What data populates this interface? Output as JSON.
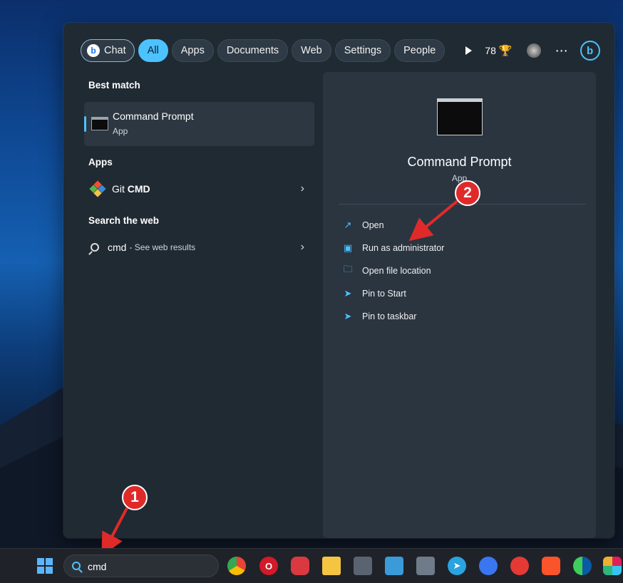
{
  "filters": {
    "chat": "Chat",
    "all": "All",
    "apps": "Apps",
    "documents": "Documents",
    "web": "Web",
    "settings": "Settings",
    "people": "People",
    "points": "78"
  },
  "left": {
    "best_match_label": "Best match",
    "best_match": {
      "title": "Command Prompt",
      "subtitle": "App"
    },
    "apps_label": "Apps",
    "apps": [
      {
        "name_prefix": "Git ",
        "name_bold": "CMD"
      }
    ],
    "web_label": "Search the web",
    "web_result": {
      "query": "cmd",
      "suffix": "- See web results"
    }
  },
  "details": {
    "title": "Command Prompt",
    "subtitle": "App",
    "actions": [
      {
        "label": "Open",
        "icon": "open-external-icon"
      },
      {
        "label": "Run as administrator",
        "icon": "shield-admin-icon"
      },
      {
        "label": "Open file location",
        "icon": "folder-icon"
      },
      {
        "label": "Pin to Start",
        "icon": "pin-icon"
      },
      {
        "label": "Pin to taskbar",
        "icon": "pin-icon"
      }
    ]
  },
  "annotations": {
    "step1": "1",
    "step2": "2",
    "color": "#e02a2a"
  },
  "taskbar": {
    "search_value": "cmd",
    "apps": [
      "chrome-icon",
      "opera-icon",
      "express-vpn-icon",
      "file-explorer-icon",
      "calculator-icon",
      "snipping-tool-icon",
      "screen-zoom-icon",
      "telegram-icon",
      "signal-icon",
      "screen-recorder-icon",
      "brave-icon",
      "edge-icon",
      "slack-icon"
    ]
  },
  "colors": {
    "accent": "#4cc2ff",
    "panel": "#202a33",
    "taskbar": "#1f2329"
  }
}
